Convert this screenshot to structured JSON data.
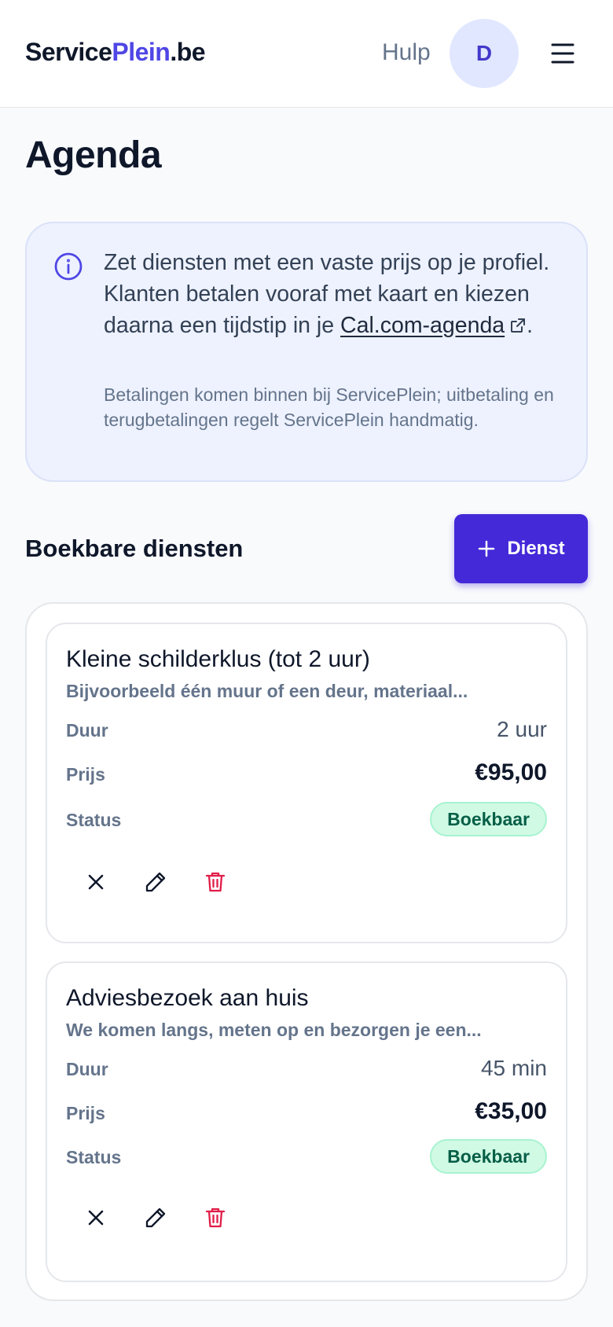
{
  "header": {
    "logo_part1": "Service",
    "logo_part2": "Plein",
    "logo_part3": ".be",
    "help_label": "Hulp",
    "avatar_initial": "D"
  },
  "page": {
    "title": "Agenda"
  },
  "info": {
    "text_before_link": "Zet diensten met een vaste prijs op je profiel. Klanten betalen vooraf met kaart en kiezen daarna een tijdstip in je ",
    "link_label": "Cal.com-agenda",
    "text_after_link": ".",
    "subtext": "Betalingen komen binnen bij ServicePlein; uitbetaling en terugbetalingen regelt ServicePlein handmatig."
  },
  "services": {
    "section_title": "Boekbare diensten",
    "add_button_label": "Dienst",
    "labels": {
      "duration": "Duur",
      "price": "Prijs",
      "status": "Status"
    },
    "items": [
      {
        "title": "Kleine schilderklus (tot 2 uur)",
        "description": "Bijvoorbeeld één muur of een deur, materiaal...",
        "duration": "2 uur",
        "price": "€95,00",
        "status": "Boekbaar"
      },
      {
        "title": "Adviesbezoek aan huis",
        "description": "We komen langs, meten op en bezorgen je een...",
        "duration": "45 min",
        "price": "€35,00",
        "status": "Boekbaar"
      }
    ]
  },
  "colors": {
    "brand": "#4f46e5",
    "primary_button": "#4329d8",
    "status_bookable_bg": "#d1fae5",
    "status_bookable_text": "#065f46",
    "delete": "#e11d48"
  },
  "icons": {
    "menu": "hamburger-menu-icon",
    "info": "info-icon",
    "external_link": "external-link-icon",
    "add": "plus-icon",
    "disable": "close-icon",
    "edit": "pencil-icon",
    "delete": "trash-icon"
  }
}
